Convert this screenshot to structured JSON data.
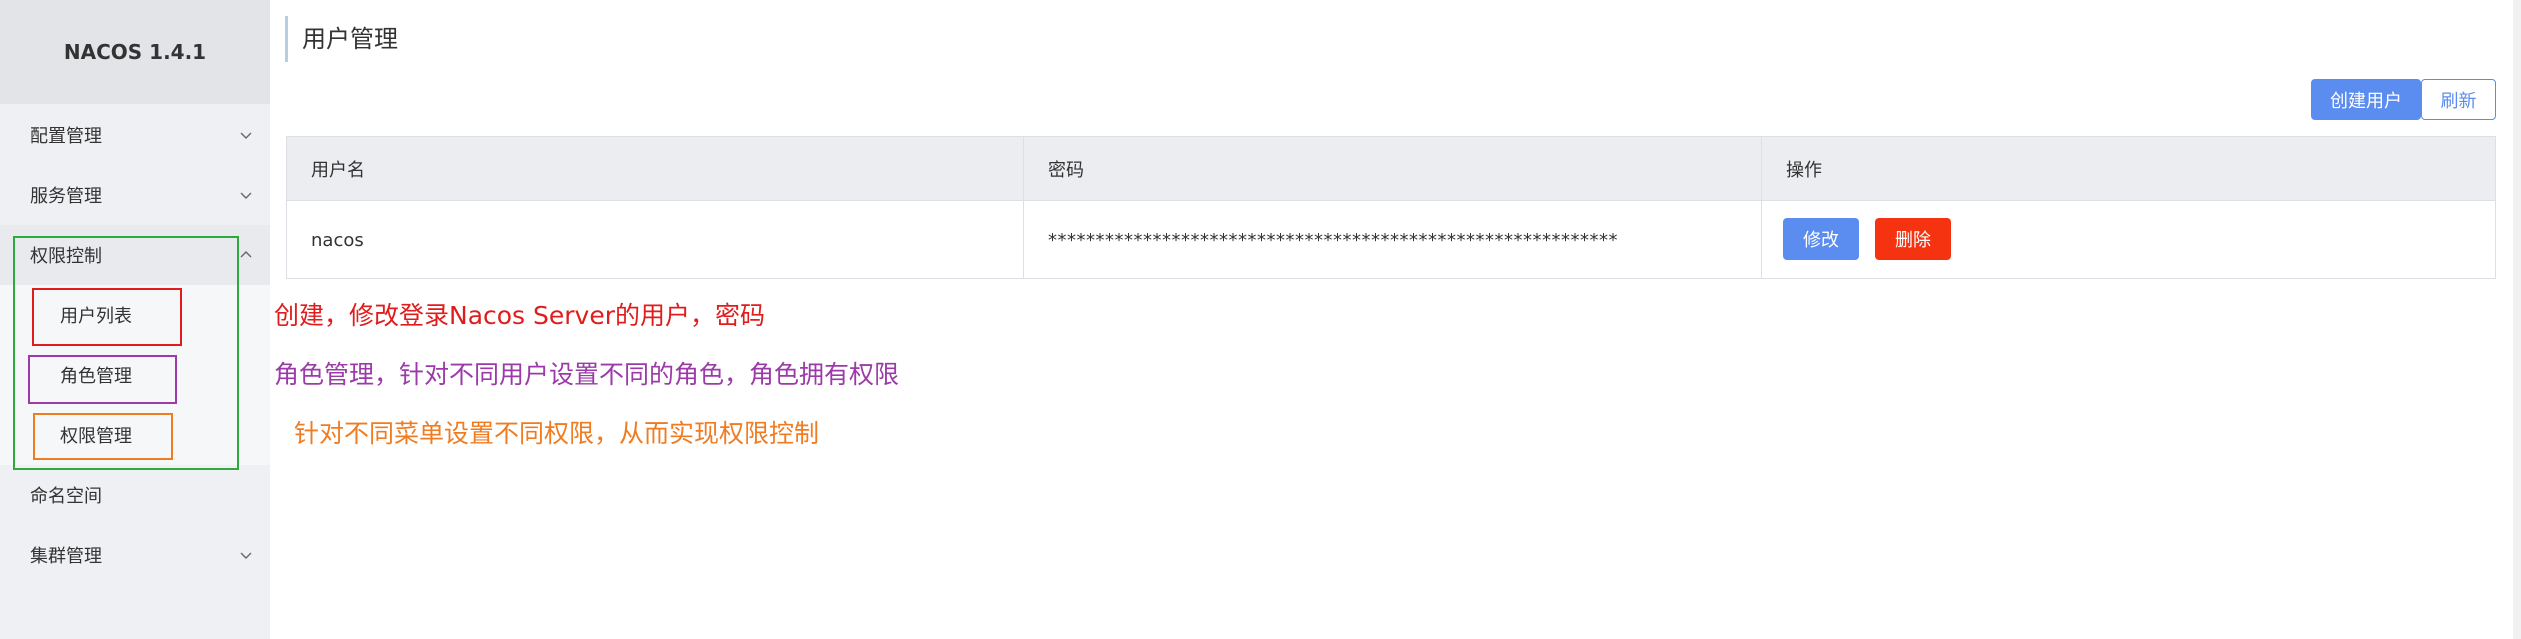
{
  "brand": "NACOS 1.4.1",
  "sidebar": {
    "items": [
      {
        "label": "配置管理"
      },
      {
        "label": "服务管理"
      },
      {
        "label": "权限控制"
      },
      {
        "label": "命名空间"
      },
      {
        "label": "集群管理"
      }
    ],
    "sub_items": [
      {
        "label": "用户列表"
      },
      {
        "label": "角色管理"
      },
      {
        "label": "权限管理"
      }
    ]
  },
  "page_title": "用户管理",
  "toolbar": {
    "create_label": "创建用户",
    "refresh_label": "刷新"
  },
  "table": {
    "columns": [
      "用户名",
      "密码",
      "操作"
    ],
    "rows": [
      {
        "username": "nacos",
        "password": "************************************************************",
        "edit_label": "修改",
        "delete_label": "删除"
      }
    ]
  },
  "annotations": [
    {
      "text": "创建，修改登录Nacos Server的用户，密码",
      "color": "#e01c1c"
    },
    {
      "text": "角色管理，针对不同用户设置不同的角色，角色拥有权限",
      "color": "#9b3aa8"
    },
    {
      "text": "针对不同菜单设置不同权限，从而实现权限控制",
      "color": "#f07c22"
    }
  ],
  "colors": {
    "primary": "#5b8cf0",
    "danger": "#f53311",
    "group_box": "#2eaa3a"
  }
}
